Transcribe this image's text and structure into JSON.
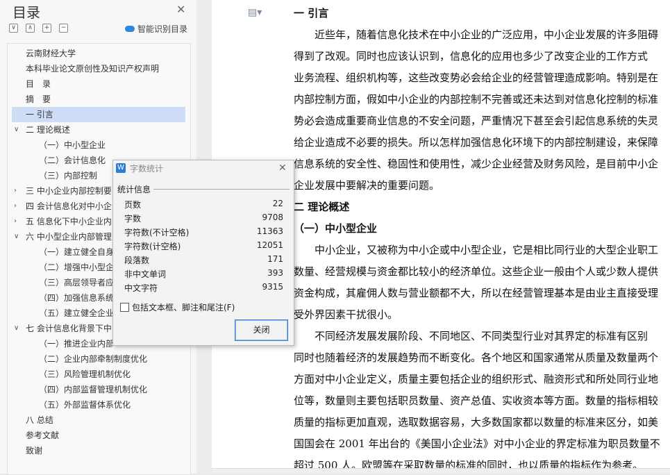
{
  "sidebar": {
    "title": "目录",
    "smart_toc_label": "智能识别目录",
    "toolbar_glyphs": [
      "∨",
      "∧",
      "+",
      "−"
    ],
    "items": [
      {
        "label": "云南财经大学",
        "level": 0
      },
      {
        "label": "本科毕业论文原创性及知识产权声明",
        "level": 0
      },
      {
        "label": "目　录",
        "level": 0
      },
      {
        "label": "摘　要",
        "level": 0
      },
      {
        "label": "一 引言",
        "level": 0,
        "selected": true
      },
      {
        "label": "二 理论概述",
        "level": 0,
        "caret": "expanded"
      },
      {
        "label": "（一）中小型企业",
        "level": 1
      },
      {
        "label": "（二）会计信息化",
        "level": 1
      },
      {
        "label": "（三）内部控制",
        "level": 1
      },
      {
        "label": "三 中小企业内部控制要",
        "level": 0,
        "caret": "collapsed"
      },
      {
        "label": "四 会计信息化对中小企",
        "level": 0,
        "caret": "collapsed"
      },
      {
        "label": "五 信息化下中小企业内",
        "level": 0,
        "caret": "collapsed"
      },
      {
        "label": "六 中小型企业内部管理",
        "level": 0,
        "caret": "expanded"
      },
      {
        "label": "（一）建立健全自身",
        "level": 1
      },
      {
        "label": "（二）增强中小型企",
        "level": 1
      },
      {
        "label": "（三）高层领导者应",
        "level": 1
      },
      {
        "label": "（四）加强信息系统",
        "level": 1
      },
      {
        "label": "（五）建立健全企业",
        "level": 1
      },
      {
        "label": "七 会计信息化背景下中",
        "level": 0,
        "caret": "expanded"
      },
      {
        "label": "（一）推进企业内部",
        "level": 1
      },
      {
        "label": "（二）企业内部牵制制度优化",
        "level": 1
      },
      {
        "label": "（三）风险管理机制优化",
        "level": 1
      },
      {
        "label": "（四）内部监督管理机制优化",
        "level": 1
      },
      {
        "label": "（五）外部监督体系优化",
        "level": 1
      },
      {
        "label": "八 总结",
        "level": 0
      },
      {
        "label": "参考文献",
        "level": 0
      },
      {
        "label": "致谢",
        "level": 0
      }
    ]
  },
  "document": {
    "lines": [
      {
        "text": "一 引言",
        "bold": true
      },
      {
        "text": "　　近些年，随着信息化技术在中小企业的广泛应用，中小企业发展的许多阻碍"
      },
      {
        "text": "得到了改观。同时也应该认识到，信息化的应用也多少了改变企业的工作方式"
      },
      {
        "text": "业务流程、组织机构等，这些改变势必会给企业的经营管理造成影响。特别是在"
      },
      {
        "text": "内部控制方面，假如中小企业的内部控制不完善或还未达到对信息化控制的标准"
      },
      {
        "text": "势必会造成重要商业信息的不安全问题，严重情况下甚至会引起信息系统的失灵"
      },
      {
        "text": "给企业造成不必要的损失。所以怎样加强信息化环境下的内部控制建设，来保障"
      },
      {
        "text": "信息系统的安全性、稳固性和使用性，减少企业经营及财务风险，是目前中小企"
      },
      {
        "text": "企业发展中要解决的重要问题。"
      },
      {
        "text": "二 理论概述",
        "bold": true
      },
      {
        "text": "（一）中小型企业",
        "bold": true
      },
      {
        "text": "　　中小企业，又被称为中小企或中小型企业，它是相比同行业的大型企业职工"
      },
      {
        "text": "数量、经营规模与资金都比较小的经济单位。这些企业一般由个人或少数人提供"
      },
      {
        "text": "资金构成，其雇佣人数与营业额都不大，所以在经营管理基本是由业主直接受理"
      },
      {
        "text": "受外界因素干扰很小。"
      },
      {
        "text": "　　不同经济发展发展阶段、不同地区、不同类型行业对其界定的标准有区别"
      },
      {
        "text": "同时也随着经济的发展趋势而不断变化。各个地区和国家通常从质量及数量两个"
      },
      {
        "text": "方面对中小企业定义，质量主要包括企业的组织形式、融资形式和所处同行业地"
      },
      {
        "text": "位等，数量则主要包括职员数量、资产总值、实收资本等方面。数量的指标相较"
      },
      {
        "text": "质量的指标更加直观，选取数据容易，大多数国家都以数量的标准来区分，如美"
      },
      {
        "text": "国国会在 2001 年出台的《美国小企业法》对中小企业的界定标准为职员数量不"
      },
      {
        "text": "超过 500 人。欧盟等在采取数量的标准的同时，也以质量的指标作为参考。"
      }
    ]
  },
  "dialog": {
    "title": "字数统计",
    "section_label": "统计信息",
    "stats": [
      {
        "label": "页数",
        "value": "22"
      },
      {
        "label": "字数",
        "value": "9708"
      },
      {
        "label": "字符数(不计空格)",
        "value": "11363"
      },
      {
        "label": "字符数(计空格)",
        "value": "12051"
      },
      {
        "label": "段落数",
        "value": "171"
      },
      {
        "label": "非中文单词",
        "value": "393"
      },
      {
        "label": "中文字符",
        "value": "9315"
      }
    ],
    "checkbox_label": "包括文本框、脚注和尾注(F)",
    "checkbox_checked": false,
    "close_label": "关闭"
  }
}
